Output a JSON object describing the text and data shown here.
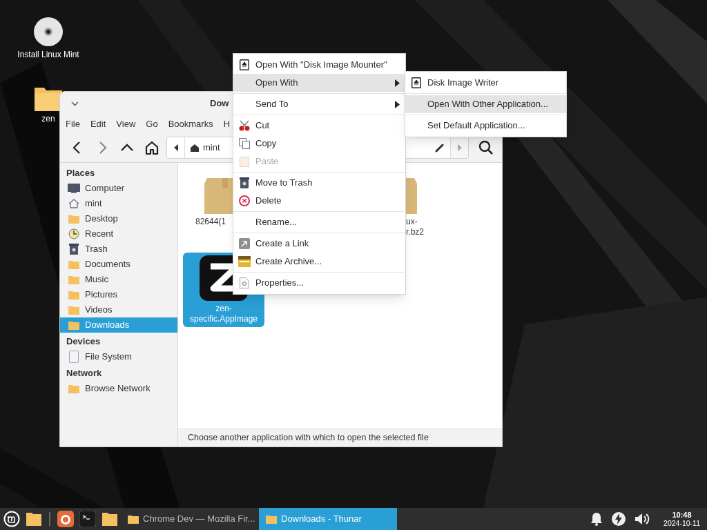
{
  "desktop_icons": [
    {
      "kind": "disc",
      "label": "Install Linux Mint"
    },
    {
      "kind": "folder",
      "label": "zen"
    }
  ],
  "window": {
    "title": "Dow",
    "menu": [
      "File",
      "Edit",
      "View",
      "Go",
      "Bookmarks",
      "H"
    ],
    "path": "mint",
    "sidebar": [
      {
        "heading": "Places",
        "items": [
          {
            "kind": "computer",
            "label": "Computer",
            "selected": false
          },
          {
            "kind": "home",
            "label": "mint",
            "selected": false
          },
          {
            "kind": "folder",
            "label": "Desktop",
            "selected": false
          },
          {
            "kind": "clock",
            "label": "Recent",
            "selected": false
          },
          {
            "kind": "trash",
            "label": "Trash",
            "selected": false
          },
          {
            "kind": "folder",
            "label": "Documents",
            "selected": false
          },
          {
            "kind": "folder",
            "label": "Music",
            "selected": false
          },
          {
            "kind": "folder",
            "label": "Pictures",
            "selected": false
          },
          {
            "kind": "folder",
            "label": "Videos",
            "selected": false
          },
          {
            "kind": "folder",
            "label": "Downloads",
            "selected": true
          }
        ]
      },
      {
        "heading": "Devices",
        "items": [
          {
            "kind": "drive",
            "label": "File System",
            "selected": false
          }
        ]
      },
      {
        "heading": "Network",
        "items": [
          {
            "kind": "folder",
            "label": "Browse Network",
            "selected": false
          }
        ]
      }
    ],
    "files": [
      {
        "kind": "package",
        "lines": [
          "82644(1"
        ],
        "selected": false
      },
      {
        "kind": "package",
        "lines": [
          "ux-",
          "r.bz2"
        ],
        "selected": false
      },
      {
        "kind": "appimage",
        "lines": [
          "zen-",
          "specific.AppImage"
        ],
        "selected": true
      }
    ],
    "status": "Choose another application with which to open the selected file"
  },
  "context_menu": {
    "groups": [
      [
        {
          "kind": "disk",
          "label": "Open With \"Disk Image Mounter\"",
          "submenu": false,
          "highlighted": false,
          "disabled": false
        },
        {
          "kind": "plain",
          "label": "Open With",
          "submenu": true,
          "highlighted": true,
          "disabled": false
        }
      ],
      [
        {
          "kind": "plain",
          "label": "Send To",
          "submenu": true,
          "highlighted": false,
          "disabled": false
        }
      ],
      [
        {
          "kind": "scissors",
          "label": "Cut",
          "submenu": false,
          "highlighted": false,
          "disabled": false
        },
        {
          "kind": "copy",
          "label": "Copy",
          "submenu": false,
          "highlighted": false,
          "disabled": false
        },
        {
          "kind": "paste",
          "label": "Paste",
          "submenu": false,
          "highlighted": false,
          "disabled": true
        }
      ],
      [
        {
          "kind": "trash",
          "label": "Move to Trash",
          "submenu": false,
          "highlighted": false,
          "disabled": false
        },
        {
          "kind": "delete",
          "label": "Delete",
          "submenu": false,
          "highlighted": false,
          "disabled": false
        }
      ],
      [
        {
          "kind": "plain",
          "label": "Rename...",
          "submenu": false,
          "highlighted": false,
          "disabled": false
        }
      ],
      [
        {
          "kind": "link",
          "label": "Create a Link",
          "submenu": false,
          "highlighted": false,
          "disabled": false
        },
        {
          "kind": "archive",
          "label": "Create Archive...",
          "submenu": false,
          "highlighted": false,
          "disabled": false
        }
      ],
      [
        {
          "kind": "properties",
          "label": "Properties...",
          "submenu": false,
          "highlighted": false,
          "disabled": false
        }
      ]
    ]
  },
  "submenu": {
    "groups": [
      [
        {
          "kind": "disk",
          "label": "Disk Image Writer",
          "submenu": false,
          "highlighted": false,
          "disabled": false
        }
      ],
      [
        {
          "kind": "plain",
          "label": "Open With Other Application...",
          "submenu": false,
          "highlighted": true,
          "disabled": false
        }
      ],
      [
        {
          "kind": "plain",
          "label": "Set Default Application...",
          "submenu": false,
          "highlighted": false,
          "disabled": false
        }
      ]
    ]
  },
  "taskbar": {
    "launchers": [
      {
        "kind": "mint"
      },
      {
        "kind": "folder"
      },
      {
        "kind": "firefox"
      },
      {
        "kind": "terminal"
      },
      {
        "kind": "folder"
      }
    ],
    "tasks": [
      {
        "label": "Chrome Dev — Mozilla Fir...",
        "selected": false
      },
      {
        "label": "Downloads - Thunar",
        "selected": true
      }
    ],
    "tray": [
      {
        "kind": "bell"
      },
      {
        "kind": "power"
      },
      {
        "kind": "volume"
      }
    ],
    "clock": {
      "time": "10:48",
      "date": "2024-10-11"
    }
  }
}
